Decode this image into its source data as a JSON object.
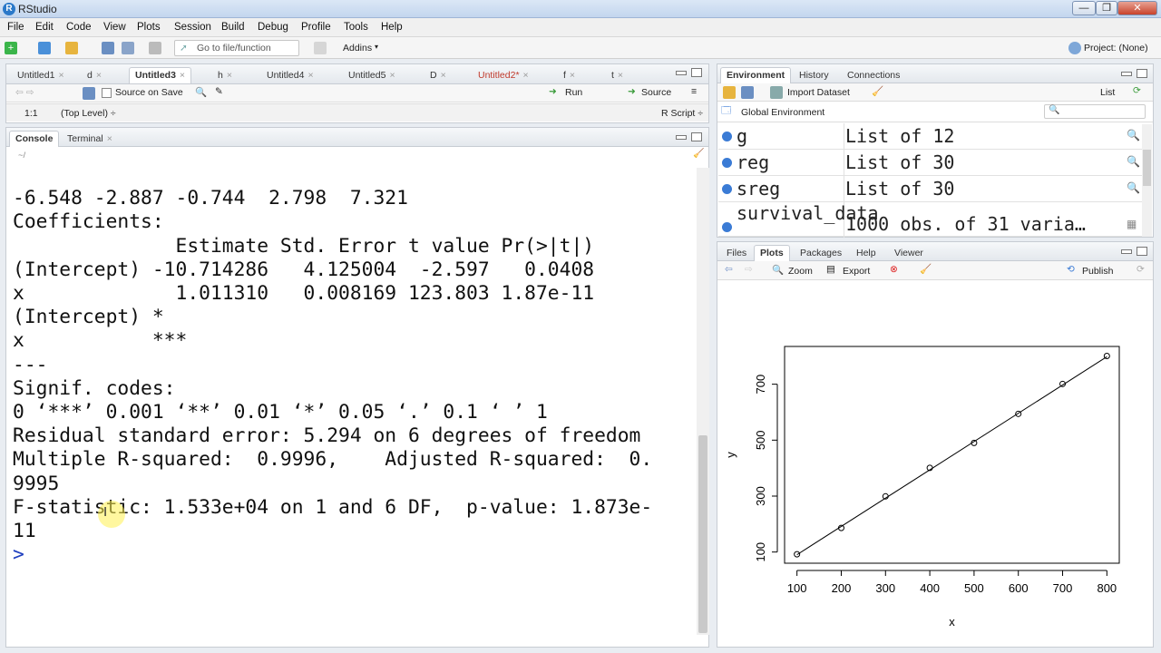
{
  "window": {
    "title": "RStudio",
    "min": "—",
    "max": "❐",
    "close": "✕"
  },
  "menu": [
    "File",
    "Edit",
    "Code",
    "View",
    "Plots",
    "Session",
    "Build",
    "Debug",
    "Profile",
    "Tools",
    "Help"
  ],
  "toolbar": {
    "goto_placeholder": "Go to file/function",
    "addins": "Addins",
    "project": "Project: (None)"
  },
  "source": {
    "tabs": [
      "Untitled1",
      "d",
      "Untitled3",
      "h",
      "Untitled4",
      "Untitled5",
      "D",
      "Untitled2*",
      "f",
      "t"
    ],
    "active_tab": "Untitled3",
    "source_on_save": "Source on Save",
    "run": "Run",
    "source_btn": "Source",
    "position": "1:1",
    "level": "(Top Level) ÷",
    "script_type": "R Script ÷"
  },
  "console": {
    "tabs": [
      "Console",
      "Terminal"
    ],
    "path": "~/",
    "lines": [
      "-6.548 -2.887 -0.744  2.798  7.321",
      "",
      "Coefficients:",
      "              Estimate Std. Error t value Pr(>|t|)",
      "(Intercept) -10.714286   4.125004  -2.597   0.0408",
      "x             1.011310   0.008169 123.803 1.87e-11",
      "",
      "(Intercept) *",
      "x           ***",
      "---",
      "Signif. codes:",
      "0 ‘***’ 0.001 ‘**’ 0.01 ‘*’ 0.05 ‘.’ 0.1 ‘ ’ 1",
      "",
      "Residual standard error: 5.294 on 6 degrees of freedom",
      "Multiple R-squared:  0.9996,    Adjusted R-squared:  0.",
      "9995",
      "F-statistic: 1.533e+04 on 1 and 6 DF,  p-value: 1.873e-",
      "11",
      "",
      ""
    ],
    "prompt": ">"
  },
  "environment": {
    "tabs": [
      "Environment",
      "History",
      "Connections"
    ],
    "import_dataset": "Import Dataset",
    "list_view": "List",
    "scope": "Global Environment",
    "rows": [
      {
        "name": "g",
        "value": "List of 12"
      },
      {
        "name": "reg",
        "value": "List of 30"
      },
      {
        "name": "sreg",
        "value": "List of 30"
      },
      {
        "name": "survival_data",
        "value": "1000 obs. of 31 varia…"
      }
    ]
  },
  "files": {
    "tabs": [
      "Files",
      "Plots",
      "Packages",
      "Help",
      "Viewer"
    ],
    "active_tab": "Plots",
    "zoom": "Zoom",
    "export": "Export",
    "publish": "Publish"
  },
  "chart_data": {
    "type": "scatter",
    "title": "",
    "xlabel": "x",
    "ylabel": "y",
    "x": [
      100,
      200,
      300,
      400,
      500,
      600,
      700,
      800
    ],
    "y": [
      92,
      186,
      299,
      401,
      490,
      594,
      701,
      801
    ],
    "fit_line": {
      "intercept": -10.714286,
      "slope": 1.01131
    },
    "xticks": [
      100,
      200,
      300,
      400,
      500,
      600,
      700,
      800
    ],
    "yticks": [
      100,
      300,
      500,
      700
    ],
    "xlim": [
      72,
      828
    ],
    "ylim": [
      60,
      835
    ],
    "grid": false,
    "legend": "none"
  }
}
